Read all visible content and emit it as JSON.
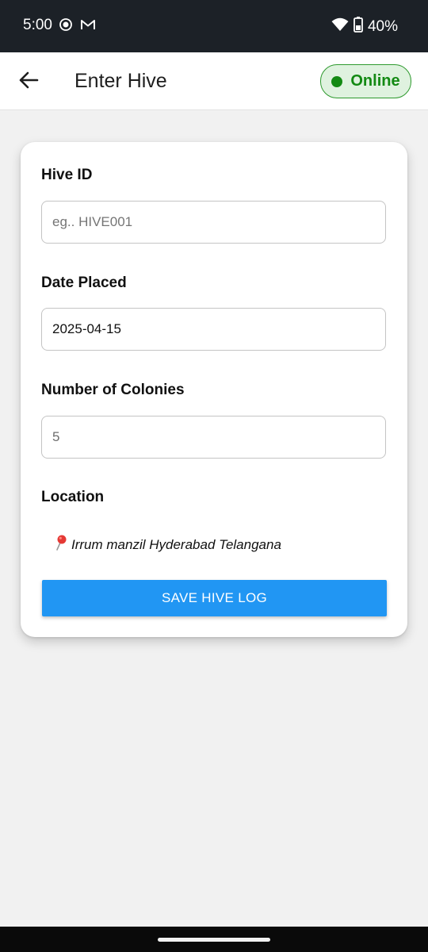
{
  "status_bar": {
    "time": "5:00",
    "battery": "40%",
    "icons": [
      "record-icon",
      "gmail-icon",
      "wifi-icon",
      "battery-icon"
    ]
  },
  "app_bar": {
    "title": "Enter Hive",
    "status_badge": "Online",
    "status_color": "#138a13"
  },
  "form": {
    "hive_id": {
      "label": "Hive ID",
      "value": "",
      "placeholder": "eg.. HIVE001"
    },
    "date_placed": {
      "label": "Date Placed",
      "value": "2025-04-15"
    },
    "colonies": {
      "label": "Number of Colonies",
      "value": "5"
    },
    "location": {
      "label": "Location",
      "icon": "pin-icon",
      "value": "Irrum manzil Hyderabad Telangana"
    },
    "save_label": "SAVE HIVE LOG"
  },
  "colors": {
    "accent": "#2196f3",
    "background": "#f1f1f1",
    "status_bar": "#1c2127"
  }
}
